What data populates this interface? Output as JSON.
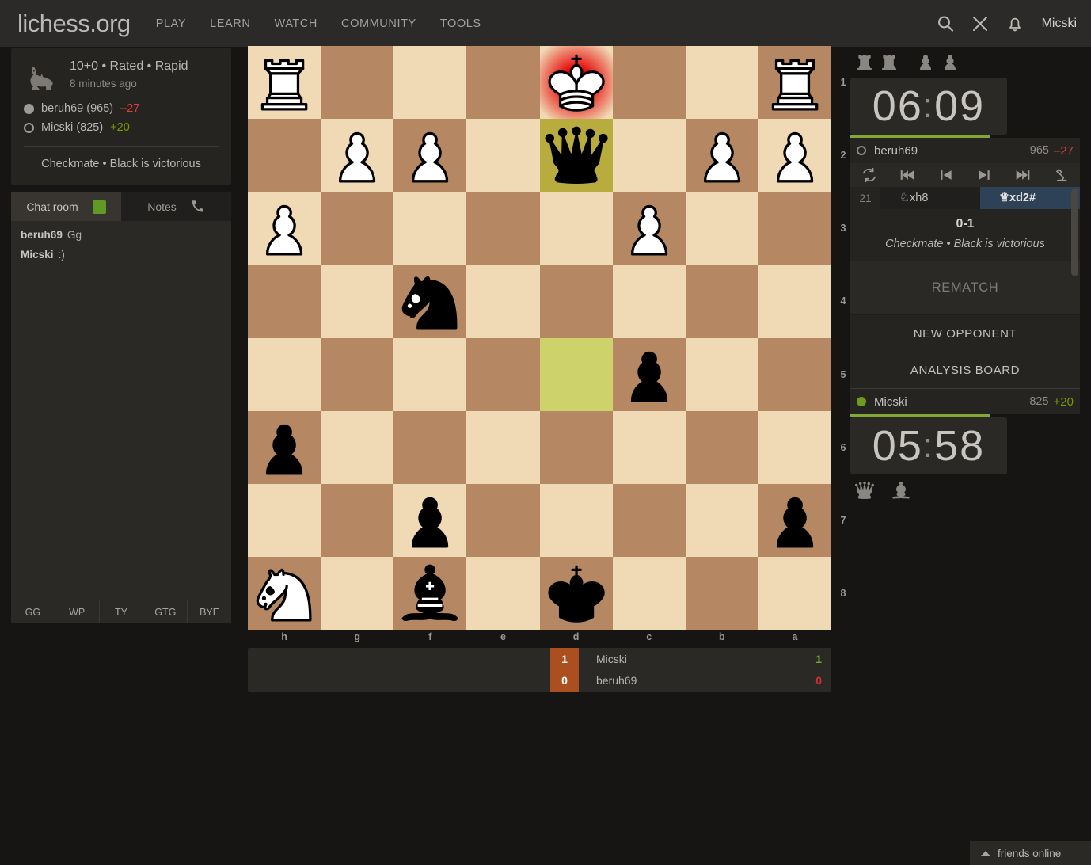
{
  "header": {
    "logo": "lichess.org",
    "nav": [
      "PLAY",
      "LEARN",
      "WATCH",
      "COMMUNITY",
      "TOOLS"
    ],
    "icons": [
      "search-icon",
      "challenge-swords-icon",
      "notification-bell-icon"
    ],
    "username": "Micski"
  },
  "game_meta": {
    "icon": "rapid-rabbit-icon",
    "time_control": "10+0 • Rated • Rapid",
    "when": "8 minutes ago",
    "players": [
      {
        "color": "black",
        "name": "beruh69",
        "rating": "(965)",
        "delta": "–27",
        "delta_sign": "minus"
      },
      {
        "color": "white",
        "name": "Micski",
        "rating": "(825)",
        "delta": "+20",
        "delta_sign": "plus"
      }
    ],
    "status": "Checkmate • Black is victorious"
  },
  "chat": {
    "tab_room": "Chat room",
    "tab_notes": "Notes",
    "messages": [
      {
        "who": "beruh69",
        "text": "Gg"
      },
      {
        "who": "Micski",
        "text": ":)"
      }
    ],
    "presets": [
      "GG",
      "WP",
      "TY",
      "GTG",
      "BYE"
    ]
  },
  "board": {
    "orientation": "black",
    "files": [
      "h",
      "g",
      "f",
      "e",
      "d",
      "c",
      "b",
      "a"
    ],
    "ranks": [
      "1",
      "2",
      "3",
      "4",
      "5",
      "6",
      "7",
      "8"
    ],
    "colors": {
      "light": "#f0d9b5",
      "dark": "#b58863",
      "highlight_light": "#cdd26a",
      "highlight_dark": "#b9ac3f",
      "check": "#e70000"
    },
    "squares": [
      [
        {
          "piece": "wR"
        },
        {},
        {},
        {},
        {
          "piece": "wK",
          "check": true
        },
        {},
        {},
        {
          "piece": "wR"
        }
      ],
      [
        {},
        {
          "piece": "wP"
        },
        {
          "piece": "wP"
        },
        {},
        {
          "piece": "bQ",
          "highlight": true
        },
        {},
        {
          "piece": "wP"
        },
        {
          "piece": "wP"
        }
      ],
      [
        {
          "piece": "wP"
        },
        {},
        {},
        {},
        {},
        {
          "piece": "wP"
        },
        {},
        {}
      ],
      [
        {},
        {},
        {
          "piece": "bN"
        },
        {},
        {},
        {},
        {},
        {}
      ],
      [
        {},
        {},
        {},
        {},
        {
          "highlight": true
        },
        {
          "piece": "bP"
        },
        {},
        {}
      ],
      [
        {
          "piece": "bP"
        },
        {},
        {},
        {},
        {},
        {},
        {},
        {}
      ],
      [
        {},
        {},
        {
          "piece": "bP"
        },
        {},
        {},
        {},
        {},
        {
          "piece": "bP"
        }
      ],
      [
        {
          "piece": "wN"
        },
        {},
        {
          "piece": "bB"
        },
        {},
        {
          "piece": "bK"
        },
        {},
        {},
        {}
      ]
    ]
  },
  "scorebar": {
    "rows": [
      {
        "score": "1",
        "name": "Micski",
        "points": "1",
        "outcome": "win"
      },
      {
        "score": "0",
        "name": "beruh69",
        "points": "0",
        "outcome": "lose"
      }
    ]
  },
  "right": {
    "top_player": {
      "captured": [
        "rook",
        "rook",
        "pawn",
        "pawn"
      ],
      "clock": {
        "minutes": "06",
        "seconds": "09"
      },
      "dot": "white",
      "name": "beruh69",
      "rating": "965",
      "delta": "–27",
      "delta_sign": "minus"
    },
    "bottom_player": {
      "captured": [
        "queen",
        "bishop"
      ],
      "clock": {
        "minutes": "05",
        "seconds": "58"
      },
      "dot": "green",
      "name": "Micski",
      "rating": "825",
      "delta": "+20",
      "delta_sign": "plus"
    },
    "nav_buttons": [
      "flip-board-icon",
      "first-move-icon",
      "previous-move-icon",
      "next-move-icon",
      "last-move-icon",
      "analysis-microscope-icon"
    ],
    "moves": [
      {
        "index": "21",
        "white": "♘xh8",
        "black": "♕xd2#",
        "current": "black"
      }
    ],
    "result_score": "0-1",
    "result_text": "Checkmate • Black is victorious",
    "actions": {
      "rematch": "REMATCH",
      "new_opponent": "NEW OPPONENT",
      "analysis_board": "ANALYSIS BOARD"
    }
  },
  "friends": {
    "label": "friends online"
  }
}
